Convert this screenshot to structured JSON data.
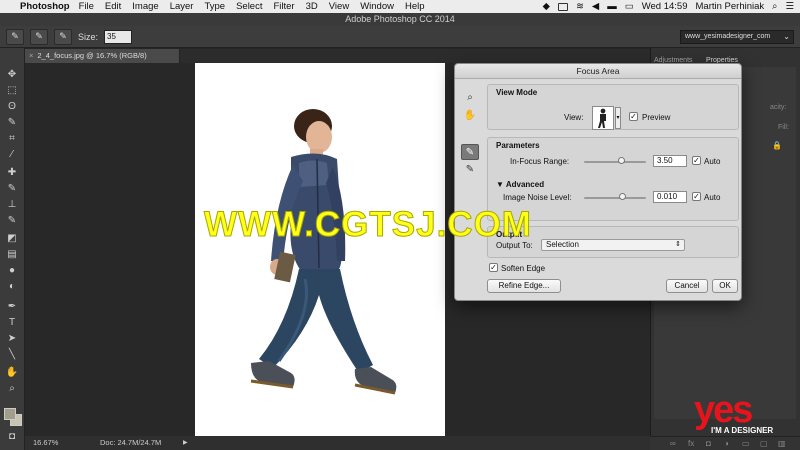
{
  "menubar": {
    "app": "Photoshop",
    "items": [
      "File",
      "Edit",
      "Image",
      "Layer",
      "Type",
      "Select",
      "Filter",
      "3D",
      "View",
      "Window",
      "Help"
    ],
    "clock": "Wed 14:59",
    "user": "Martin Perhiniak"
  },
  "window": {
    "title": "Adobe Photoshop CC 2014"
  },
  "options": {
    "size_label": "Size:",
    "size_value": "35",
    "workspace_value": "www_yesimadesigner_com"
  },
  "document": {
    "tab_label": "2_4_focus.jpg @ 16.7% (RGB/8)",
    "zoom": "16.67%",
    "doc_size": "Doc: 24.7M/24.7M"
  },
  "panels": {
    "tabs": [
      "Adjustments",
      "Properties"
    ],
    "row_opacity": "acity:",
    "row_fill": "Fill:"
  },
  "dialog": {
    "title": "Focus Area",
    "view_mode": {
      "title": "View Mode",
      "view_label": "View:",
      "preview_label": "Preview",
      "preview_checked": true
    },
    "parameters": {
      "title": "Parameters",
      "range_label": "In-Focus Range:",
      "range_value": "3.50",
      "range_fraction": 0.6,
      "auto_label": "Auto",
      "auto_checked": true
    },
    "advanced": {
      "title": "Advanced",
      "noise_label": "Image Noise Level:",
      "noise_value": "0.010",
      "noise_fraction": 0.62,
      "auto_label": "Auto",
      "auto_checked": true
    },
    "output": {
      "title": "Output",
      "output_label": "Output To:",
      "output_value": "Selection"
    },
    "soften_label": "Soften Edge",
    "soften_checked": true,
    "refine_button": "Refine Edge...",
    "cancel_button": "Cancel",
    "ok_button": "OK"
  },
  "watermarks": {
    "cgtsj": "WWW.CGTSJ.COM",
    "yes": "yes",
    "yes_sub": "I'M A DESIGNER"
  }
}
